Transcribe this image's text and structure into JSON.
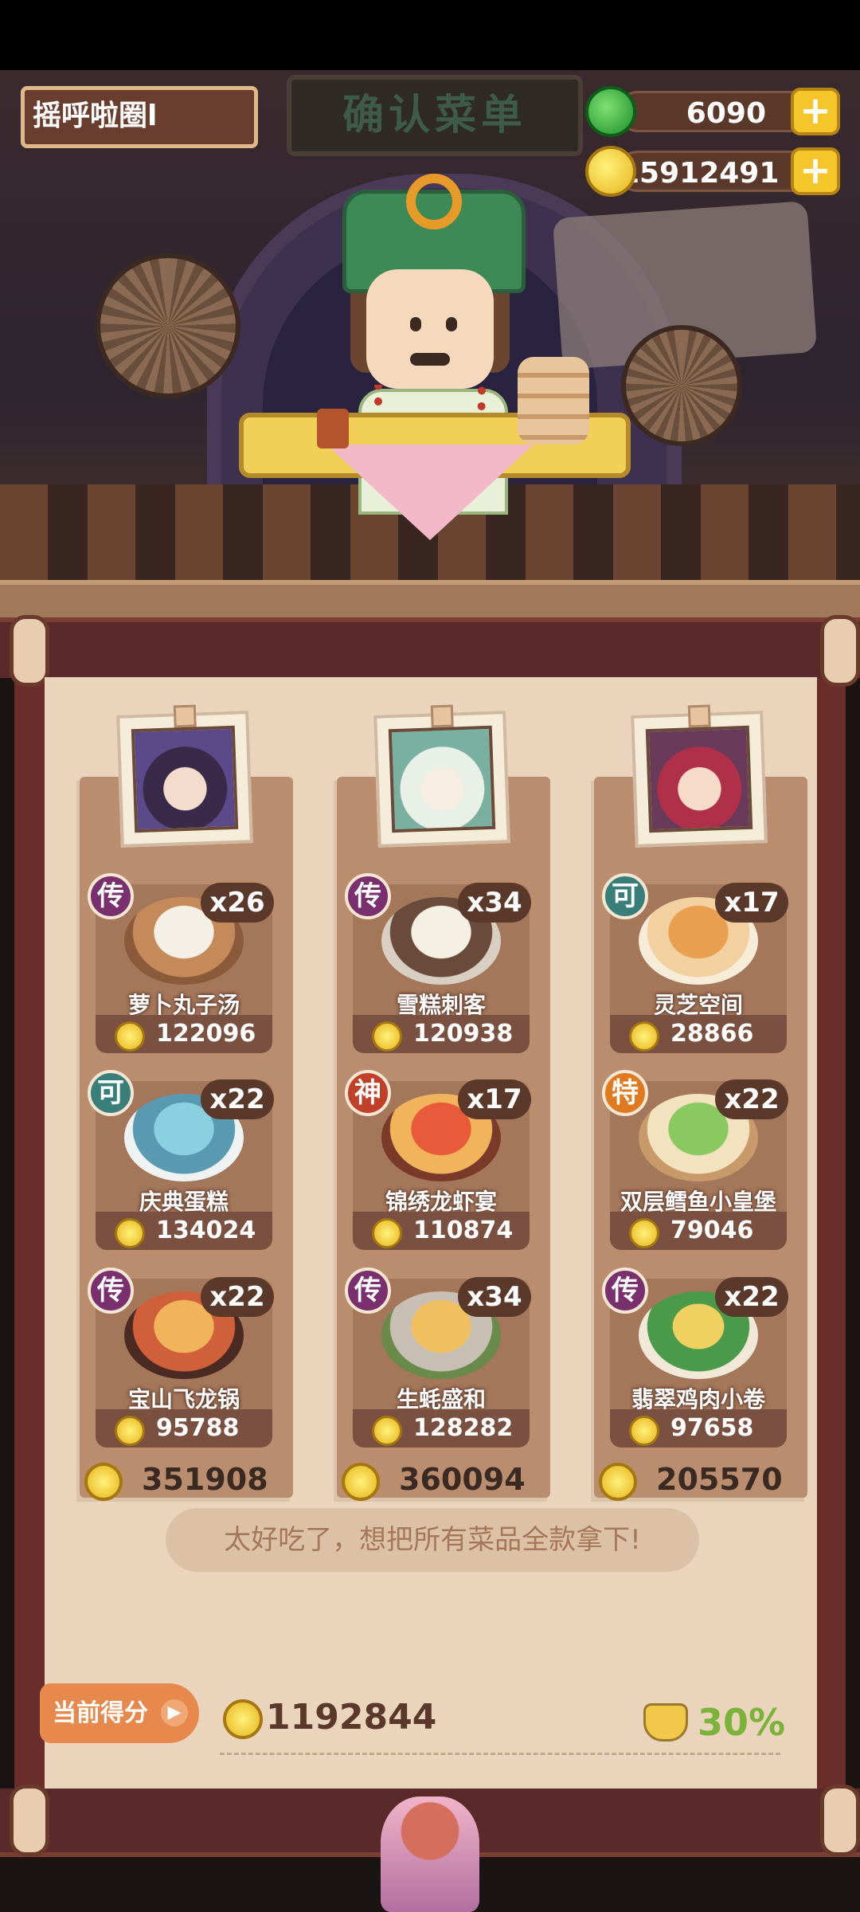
{
  "header": {
    "player_name": "摇呼啦圈l",
    "sign_title": "确认菜单"
  },
  "currency": [
    {
      "name": "jade",
      "value": "6090",
      "plus": "+"
    },
    {
      "name": "coin",
      "value": "15912491",
      "plus": "+"
    }
  ],
  "columns": [
    {
      "total": "351908",
      "dishes": [
        {
          "rank": "传",
          "qty": "x26",
          "name": "萝卜丸子汤",
          "price": "122096"
        },
        {
          "rank": "可",
          "qty": "x22",
          "name": "庆典蛋糕",
          "price": "134024"
        },
        {
          "rank": "传",
          "qty": "x22",
          "name": "宝山飞龙锅",
          "price": "95788"
        }
      ]
    },
    {
      "total": "360094",
      "dishes": [
        {
          "rank": "传",
          "qty": "x34",
          "name": "雪糕刺客",
          "price": "120938"
        },
        {
          "rank": "神",
          "qty": "x17",
          "name": "锦绣龙虾宴",
          "price": "110874"
        },
        {
          "rank": "传",
          "qty": "x34",
          "name": "生蚝盛和",
          "price": "128282"
        }
      ]
    },
    {
      "total": "205570",
      "dishes": [
        {
          "rank": "可",
          "qty": "x17",
          "name": "灵芝空间",
          "price": "28866"
        },
        {
          "rank": "特",
          "qty": "x22",
          "name": "双层鳕鱼小皇堡",
          "price": "79046"
        },
        {
          "rank": "传",
          "qty": "x22",
          "name": "翡翠鸡肉小卷",
          "price": "97658"
        }
      ]
    }
  ],
  "comment": "太好吃了，想把所有菜品全款拿下!",
  "score": {
    "label": "当前得分",
    "value": "1192844",
    "bonus": "30%"
  },
  "colors": {
    "rank_chuan": "#7a2f6e",
    "rank_ke": "#3a7e7a",
    "rank_shen": "#c0402a",
    "rank_te": "#e07a20",
    "bonus_green": "#7ab23a"
  }
}
